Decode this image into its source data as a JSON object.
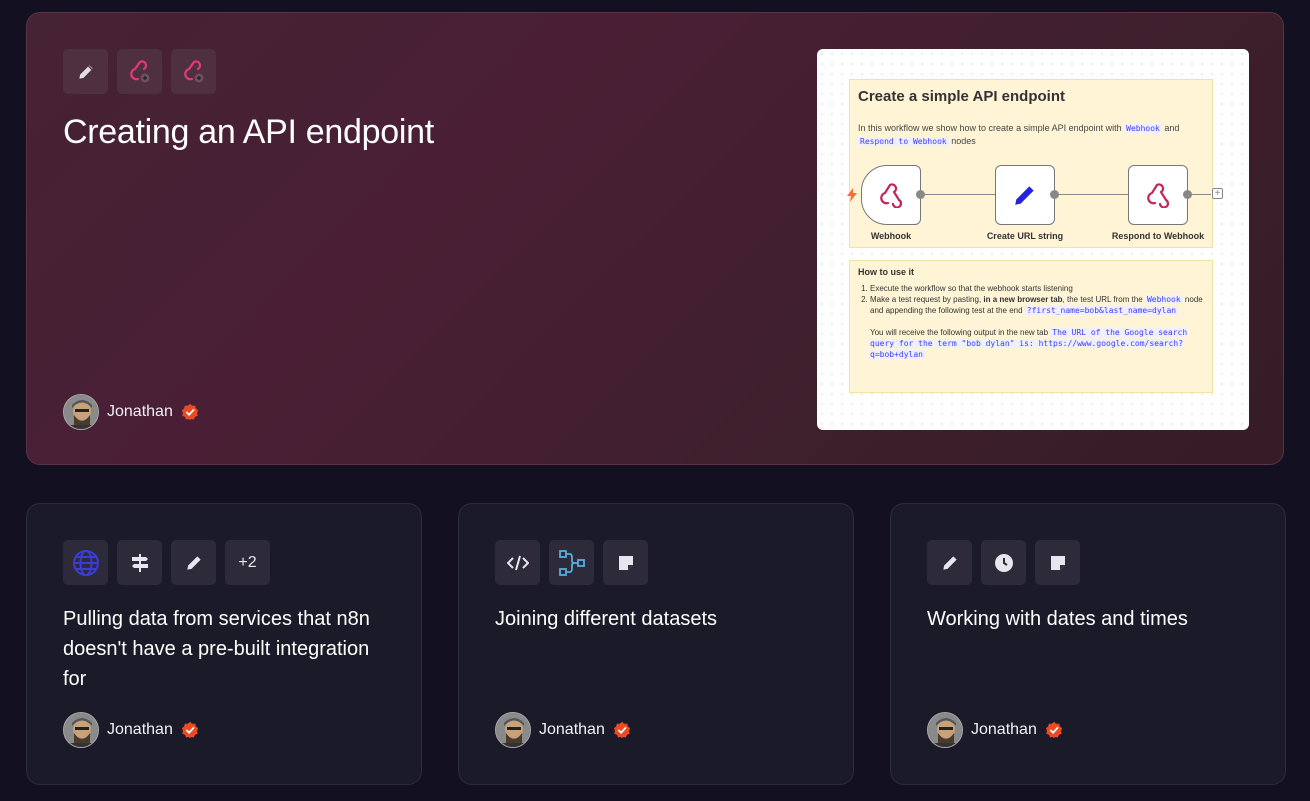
{
  "hero": {
    "title": "Creating an API endpoint",
    "icons": [
      "pencil-icon",
      "webhook-icon",
      "webhook-icon"
    ],
    "author": "Jonathan",
    "preview": {
      "note_title": "Create a simple API endpoint",
      "desc_prefix": "In this workflow we show how to create a simple API endpoint with",
      "desc_code1": "Webhook",
      "desc_and": "and",
      "desc_code2": "Respond to Webhook",
      "desc_suffix": "nodes",
      "nodes": [
        "Webhook",
        "Create URL string",
        "Respond to Webhook"
      ],
      "howto_title": "How to use it",
      "step1": "Execute the workflow so that the webhook starts listening",
      "step2_a": "Make a test request by pasting,",
      "step2_bold": "in a new browser tab",
      "step2_b": ", the test URL from the",
      "step2_code1": "Webhook",
      "step2_c": "node and appending the following test at the end",
      "step2_code2": "?first_name=bob&last_name=dylan",
      "output_text": "You will receive the following output in the new tab",
      "output_code": "The URL of the Google search query for the term \"bob dylan\" is: https://www.google.com/search?q=bob+dylan"
    }
  },
  "cards": [
    {
      "title": "Pulling data from services that n8n doesn't have a pre-built integration for",
      "icons": [
        "globe-icon",
        "signpost-icon",
        "pencil-icon"
      ],
      "more": "+2",
      "author": "Jonathan"
    },
    {
      "title": "Joining different datasets",
      "icons": [
        "code-icon",
        "merge-icon",
        "sticky-note-icon"
      ],
      "author": "Jonathan"
    },
    {
      "title": "Working with dates and times",
      "icons": [
        "pencil-icon",
        "clock-icon",
        "sticky-note-icon"
      ],
      "author": "Jonathan"
    }
  ],
  "colors": {
    "background": "#131121",
    "verified": "#ea4b24",
    "webhook": "#c4245a",
    "globe": "#3b3bd8",
    "merge": "#56aee0"
  }
}
